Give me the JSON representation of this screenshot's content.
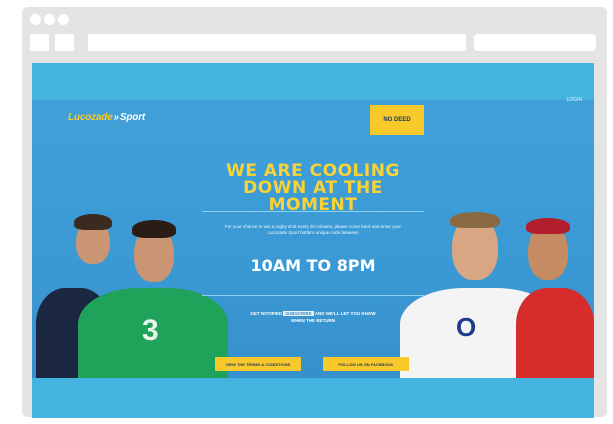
{
  "browser": {
    "url": "",
    "search": ""
  },
  "site": {
    "logo_text": "Lucozade",
    "logo_arrow": "»",
    "logo_sport": "Sport",
    "help_button": "NO DEED",
    "login_link": "LOGIN"
  },
  "hero": {
    "headline": "WE ARE COOLING DOWN AT THE MOMENT",
    "info_text": "For your chance to win a rugby shirt every 20 minutes, please come back and enter your Lucozade Sport bottle's unique code between",
    "hours": "10AM TO 8PM",
    "notify_prefix": "GET NOTIFIED",
    "notify_chip": "SUBSCRIBE",
    "notify_suffix": "AND WE'LL LET YOU KNOW WHEN THE RETURN",
    "cta_left": "VIEW THE TERMS & CONDITIONS",
    "cta_right": "FOLLOW US ON FACEBOOK"
  },
  "colors": {
    "sky": "#45b3e0",
    "header": "#3f9fd6",
    "accent_yellow": "#f7c92b"
  }
}
